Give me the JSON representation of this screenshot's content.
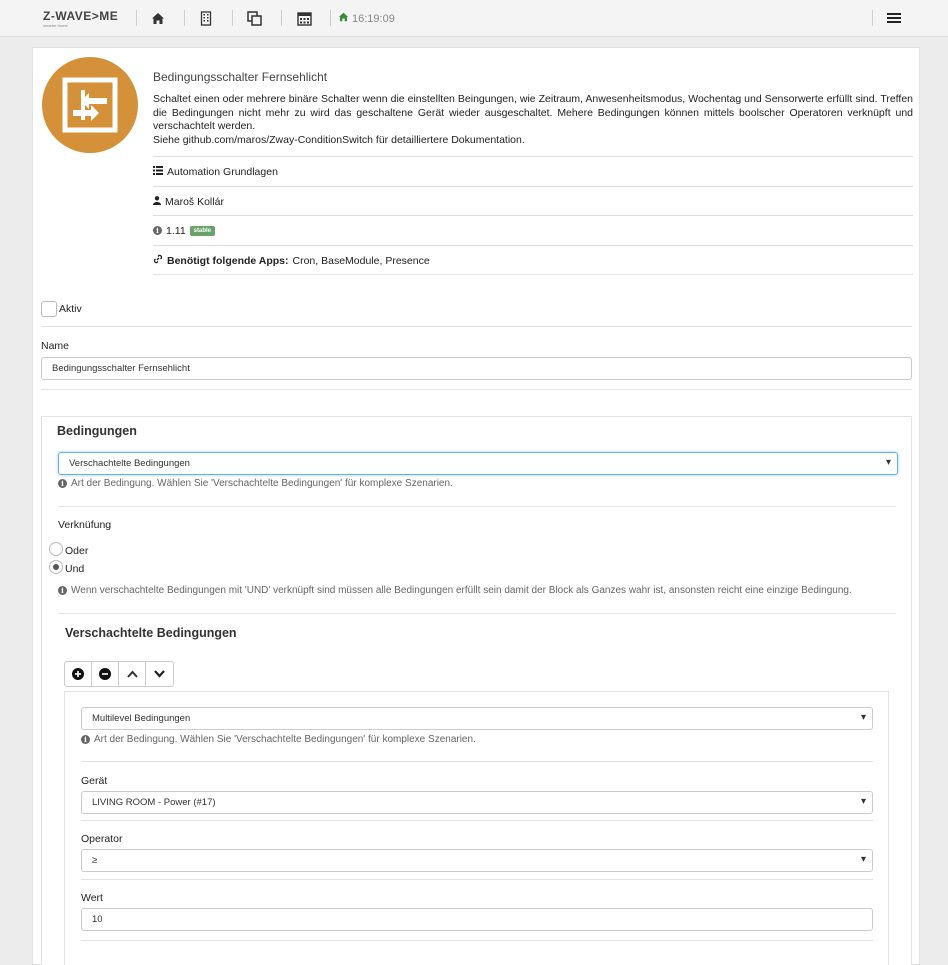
{
  "topbar": {
    "logo": "Z-WAVE>ME",
    "logo_sub": "smarter home",
    "time": "16:19:09"
  },
  "app": {
    "title": "Bedingungsschalter Fernsehlicht",
    "description_line1": "Schaltet einen oder mehrere binäre Schalter wenn die einstellten Beingungen, wie Zeitraum, Anwesenheitsmodus, Wochentag und Sensorwerte erfüllt sind. Treffen die Bedingungen nicht mehr zu wird das geschaltene Gerät wieder ausgeschaltet. Mehere Bedingungen können mittels boolscher Operatoren verknüpft und verschachtelt werden.",
    "description_line2": "Siehe github.com/maros/Zway-ConditionSwitch für detailliertere Dokumentation.",
    "category": "Automation Grundlagen",
    "author": "Maroš Kollár",
    "version": "1.11",
    "badge": "stable",
    "deps_label": "Benötigt folgende Apps:",
    "deps_value": "Cron, BaseModule, Presence"
  },
  "form": {
    "active_label": "Aktiv",
    "name_label": "Name",
    "name_value": "Bedingungsschalter Fernsehlicht",
    "conditions_title": "Bedingungen",
    "condition_type": "Verschachtelte Bedingungen",
    "condition_help": "Art der Bedingung. Wählen Sie 'Verschachtelte Bedingungen' für komplexe Szenarien.",
    "logic_label": "Verknüfung",
    "logic_or": "Oder",
    "logic_and": "Und",
    "logic_help": "Wenn verschachtelte Bedingungen mit 'UND' verknüpft sind müssen alle Bedingungen erfüllt sein damit der Block als Ganzes wahr ist, ansonsten reicht eine einzige Bedingung.",
    "nested_title": "Verschachtelte Bedingungen",
    "nested_type": "Multilevel Bedingungen",
    "nested_help": "Art der Bedingung. Wählen Sie 'Verschachtelte Bedingungen' für komplexe Szenarien.",
    "device_label": "Gerät",
    "device_value": "LIVING ROOM - Power (#17)",
    "operator_label": "Operator",
    "operator_value": "≥",
    "value_label": "Wert",
    "value_value": "10"
  },
  "colors": {
    "logo_orange": "#d4913a",
    "badge_green": "#6aa36a",
    "focus_blue": "#66afe9"
  }
}
